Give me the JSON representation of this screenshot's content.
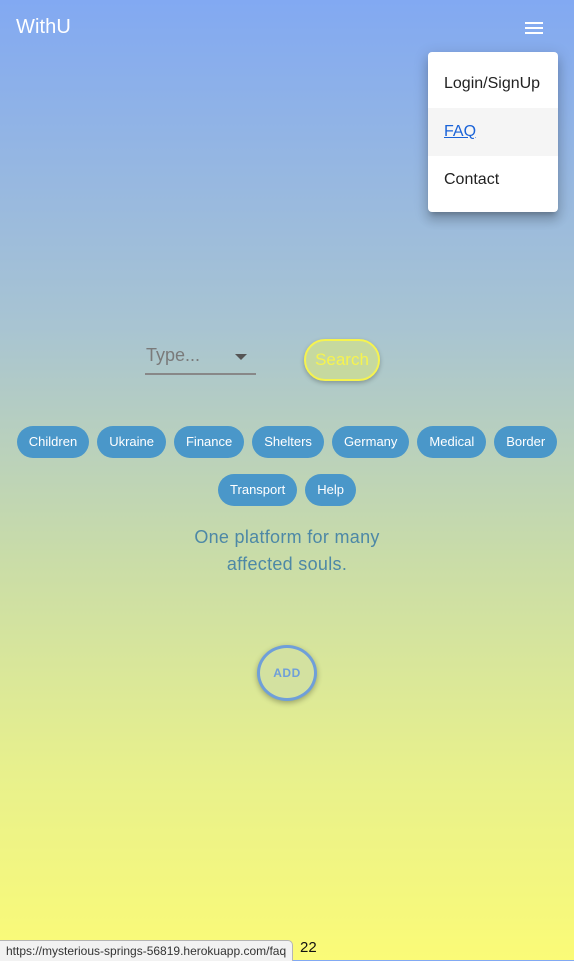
{
  "app": {
    "brand": "WithU"
  },
  "menu": {
    "items": [
      {
        "label": "Login/SignUp"
      },
      {
        "label": "FAQ"
      },
      {
        "label": "Contact"
      }
    ]
  },
  "search": {
    "placeholder": "Type...",
    "button_label": "Search"
  },
  "tags": [
    {
      "label": "Children"
    },
    {
      "label": "Ukraine"
    },
    {
      "label": "Finance"
    },
    {
      "label": "Shelters"
    },
    {
      "label": "Germany"
    },
    {
      "label": "Medical"
    },
    {
      "label": "Border"
    },
    {
      "label": "Transport"
    },
    {
      "label": "Help"
    }
  ],
  "tagline": {
    "line1": "One platform for many",
    "line2": "affected souls."
  },
  "add_button": "ADD",
  "footer": {
    "partial_text": "22"
  },
  "browser": {
    "status_url": "https://mysterious-springs-56819.herokuapp.com/faq"
  },
  "colors": {
    "chip": "#4a97c9",
    "search_accent": "#f6f34f",
    "add_accent": "#6f9fd9",
    "gradient_top": "#82a9f2",
    "gradient_bottom": "#fbfb77"
  },
  "icons": {
    "menu": "hamburger-menu-icon",
    "select_caret": "caret-down-icon"
  }
}
